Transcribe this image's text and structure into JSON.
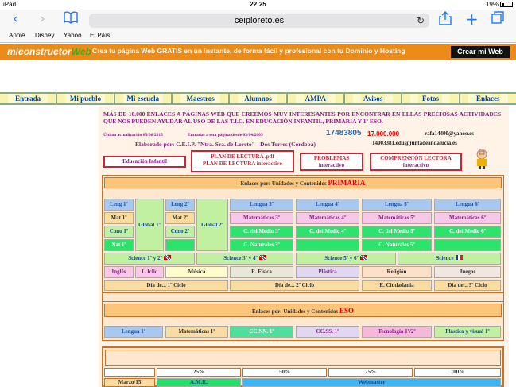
{
  "status": {
    "device": "iPad",
    "time": "22:25",
    "battery": "19%"
  },
  "browser": {
    "url": "ceiploreto.es",
    "bookmarks": [
      "Apple",
      "Disney",
      "Yahoo",
      "El País"
    ]
  },
  "ad": {
    "logo_prefix": "mi",
    "logo_main": "constructor",
    "logo_suffix": "Web",
    "text": "Crea tu página Web GRATIS en un instante, de forma fácil y profesional con tu Dominio y Hosting",
    "cta": "Crear mi Web"
  },
  "menu": [
    "Entrada",
    "Mi pueblo",
    "Mi escuela",
    "Maestros",
    "Alumnos",
    "AMPA",
    "Avisos",
    "Fotos",
    "Enlaces"
  ],
  "intro": {
    "text": "MÁS DE 10.000 ENLACES A PÁGINAS WEB QUE CREEMOS MUY INTERESANTES POR ENCONTRAR EN ELLAS PRECIOSAS ACTIVIDADES QUE NOS PUEDEN AYUDAR AL USO DE LAS T.I.C. EN EDUCACIÓN INFANTIL, PRIMARIA Y 1º ESO.",
    "updated": "Última actualización 05/06/2015",
    "entries": "Entradas a esta página desde 03/04/2009",
    "counter": "17483805",
    "counter2": "17.000.000",
    "email1": "rafa14400@yahoo.es",
    "email2": "14003381.edu@juntadeandalucia.es",
    "elaborado": "Elaborado por: C.E.I.P. \"Ntra. Sra. de Loreto\" - Dos Torres (Córdoba)"
  },
  "buttons": {
    "infantil": "Educación Infantil",
    "plan1": "PLAN DE LECTURA .pdf",
    "plan2": "PLAN DE LECTURA interactivo",
    "problemas1": "PROBLEMAS",
    "problemas2": "interactivo",
    "comprension1": "COMPRENSIÓN LECTORA",
    "comprension2": "interactivo"
  },
  "primaria": {
    "title": "Enlaces por: Unidades y Contenidos",
    "title_red": "PRIMARIA",
    "lengua": [
      "Leng 1º",
      "Leng 2º",
      "Lengua 3º",
      "Lengua 4º",
      "Lengua 5º",
      "Lengua 6º"
    ],
    "mat": [
      "Mat 1º",
      "Mat 2º",
      "Matemáticas 3º",
      "Matemáticas 4º",
      "Matemáticas 5º",
      "Matemáticas 6º"
    ],
    "cono": [
      "Cono 1º",
      "Cono 2º",
      "C. del Medio 3º",
      "C. del Medio 4º",
      "C. del Medio 5º",
      "C. del Medio 6º"
    ],
    "nat": [
      "Nat 1º",
      "C. Naturales 3º",
      "C. Naturales 5º"
    ],
    "global1": "Global 1º",
    "global2": "Global 2º",
    "science": [
      "Science 1º y 2º",
      "Science 3º y 4º",
      "Science 5º y 6º",
      "Science"
    ],
    "misc": [
      "Inglés",
      "I .Jclic",
      "Música",
      "E. Física",
      "Plástica",
      "Religión",
      "Juegos"
    ],
    "dia": [
      "Día de... 1º Ciclo",
      "Día de... 2º Ciclo",
      "E. Ciudadanía",
      "Día de... 3º Ciclo"
    ]
  },
  "eso": {
    "title": "Enlaces por: Unidades y Contenidos",
    "title_red": "ESO",
    "items": [
      "Lengua 1º",
      "Matemáticas 1º",
      "CC.NN. 1º",
      "CC.SS. 1º",
      "Tecnología 1º/2º",
      "Plástica y visual 1º"
    ]
  },
  "bottom": {
    "percents": [
      "25%",
      "50%",
      "75%",
      "100%"
    ],
    "date": "Marzo/15",
    "amr": "A.M.R.",
    "webmaster": "Webmaster"
  }
}
